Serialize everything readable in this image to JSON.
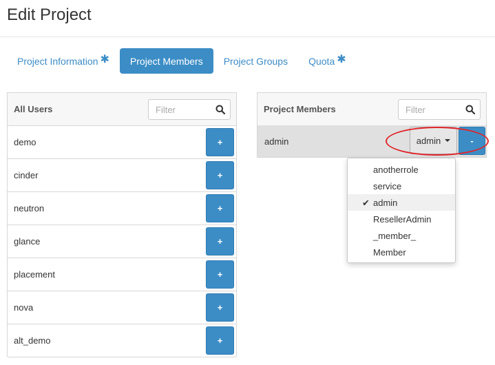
{
  "modal": {
    "title": "Edit Project"
  },
  "tabs": [
    {
      "label": "Project Information",
      "required": true,
      "active": false
    },
    {
      "label": "Project Members",
      "required": false,
      "active": true
    },
    {
      "label": "Project Groups",
      "required": false,
      "active": false
    },
    {
      "label": "Quota",
      "required": true,
      "active": false
    }
  ],
  "required_marker": "✱",
  "all_users": {
    "heading": "All Users",
    "filter_placeholder": "Filter",
    "add_label": "+",
    "users": [
      "demo",
      "cinder",
      "neutron",
      "glance",
      "placement",
      "nova",
      "alt_demo"
    ]
  },
  "project_members": {
    "heading": "Project Members",
    "filter_placeholder": "Filter",
    "remove_label": "-",
    "members": [
      {
        "name": "admin",
        "role": "admin"
      }
    ]
  },
  "role_dropdown": {
    "options": [
      "anotherrole",
      "service",
      "admin",
      "ResellerAdmin",
      "_member_",
      "Member"
    ],
    "selected": "admin",
    "check_glyph": "✔"
  },
  "colors": {
    "primary": "#3c8dc6",
    "highlight": "#e0262b"
  },
  "icons": {
    "filter": "search-icon",
    "role_toggle": "caret-down-icon",
    "selected_role": "checkmark-icon"
  }
}
